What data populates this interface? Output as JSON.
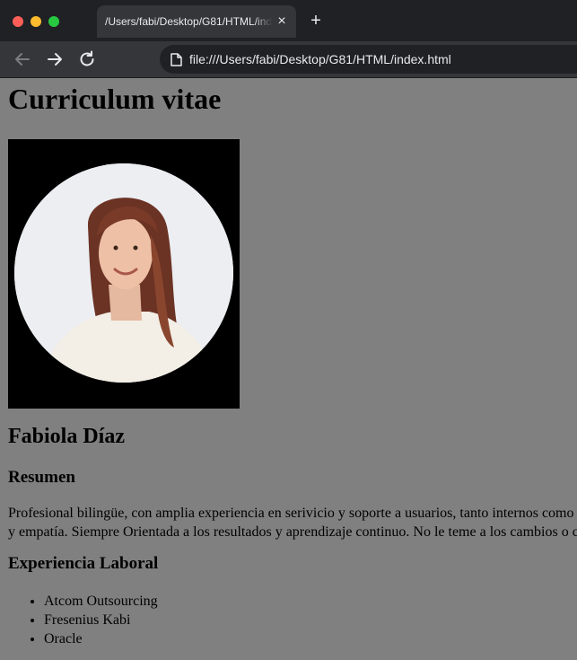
{
  "browser": {
    "tab": {
      "title": "/Users/fabi/Desktop/G81/HTML/index.html"
    },
    "address": {
      "url": "file:///Users/fabi/Desktop/G81/HTML/index.html"
    }
  },
  "page": {
    "title": "Curriculum vitae",
    "name": "Fabiola Díaz",
    "summary": {
      "heading": "Resumen",
      "line1": "Profesional bilingüe, con amplia experiencia en serivicio y soporte a usuarios, tanto internos como",
      "line2": "y empatía. Siempre Orientada a los resultados y aprendizaje continuo. No le teme a los cambios o c"
    },
    "experience": {
      "heading": "Experiencia Laboral",
      "items": [
        "Atcom Outsourcing",
        "Fresenius Kabi",
        "Oracle"
      ]
    }
  },
  "colors": {
    "page_background": "#808080",
    "photo_frame": "#000000"
  }
}
